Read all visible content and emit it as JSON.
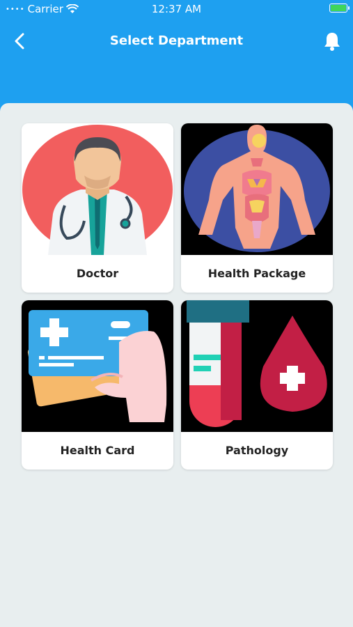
{
  "status": {
    "carrier": "Carrier",
    "time": "12:37 AM"
  },
  "nav": {
    "title": "Select Department"
  },
  "colors": {
    "header": "#1ea0f0",
    "panel": "#e8eeef",
    "battery": "#3fd55b"
  },
  "departments": [
    {
      "label": "Doctor"
    },
    {
      "label": "Health Package"
    },
    {
      "label": "Health Card"
    },
    {
      "label": "Pathology"
    }
  ]
}
